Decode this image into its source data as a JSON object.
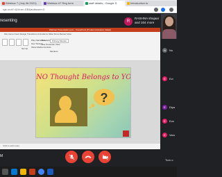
{
  "browser": {
    "tabs": [
      {
        "label": "Webinar 7 (July 06.2021)",
        "color": "#ea4335",
        "active": false
      },
      {
        "label": "Webinar #7 Reg form",
        "color": "#673ab7",
        "active": false
      },
      {
        "label": "staff details - Google S",
        "color": "#0f9d58",
        "active": false
      },
      {
        "label": "Introduction to",
        "color": "#f4b400",
        "active": false
      }
    ],
    "url": "rgb-oruV=&hl=en-GB&authuser=0"
  },
  "meet": {
    "presenting_label": "resenting",
    "presenter_initial": "R",
    "presenter_label": "RASHNA shajaar and 104 more",
    "participants": [
      {
        "initial": "N",
        "name": "Nu",
        "color": "#e8eaed"
      },
      {
        "initial": "E",
        "name": "Evi",
        "color": "#e91e63"
      },
      {
        "initial": "E",
        "name": "Diya",
        "color": "#7b1fa2"
      },
      {
        "initial": "E",
        "name": "Eve",
        "color": "#e91e63"
      },
      {
        "initial": "E",
        "name": "Varu",
        "color": "#e91e63"
      }
    ],
    "turn_off_label": "Turn o",
    "meeting_code_fragment": "M"
  },
  "powerpoint": {
    "title_bar": "Webinar Presentation.pptx - PowerPoint (Product Activation Failed)",
    "ribbon_tabs": "File   Home   Insert   Design   Transitions   Animations   Slide Show   Review   View",
    "ribbon_items": {
      "play_from": "Play Narrations",
      "use_timings": "Use Timings",
      "show_media": "Show Media Controls",
      "resolution_label": "Resolution:",
      "resolution_value": "Primary Monitor",
      "presenter_view": "Use Presenter View",
      "group_label": "Set Up",
      "monitors_label": "Monitors"
    },
    "status_bar": "Click to add notes"
  },
  "slide": {
    "title": "NO Thought Belongs to YOU"
  },
  "colors": {
    "accent_red": "#ea4335",
    "ppt_red": "#c43e1c",
    "slide_title": "#d81b60"
  }
}
